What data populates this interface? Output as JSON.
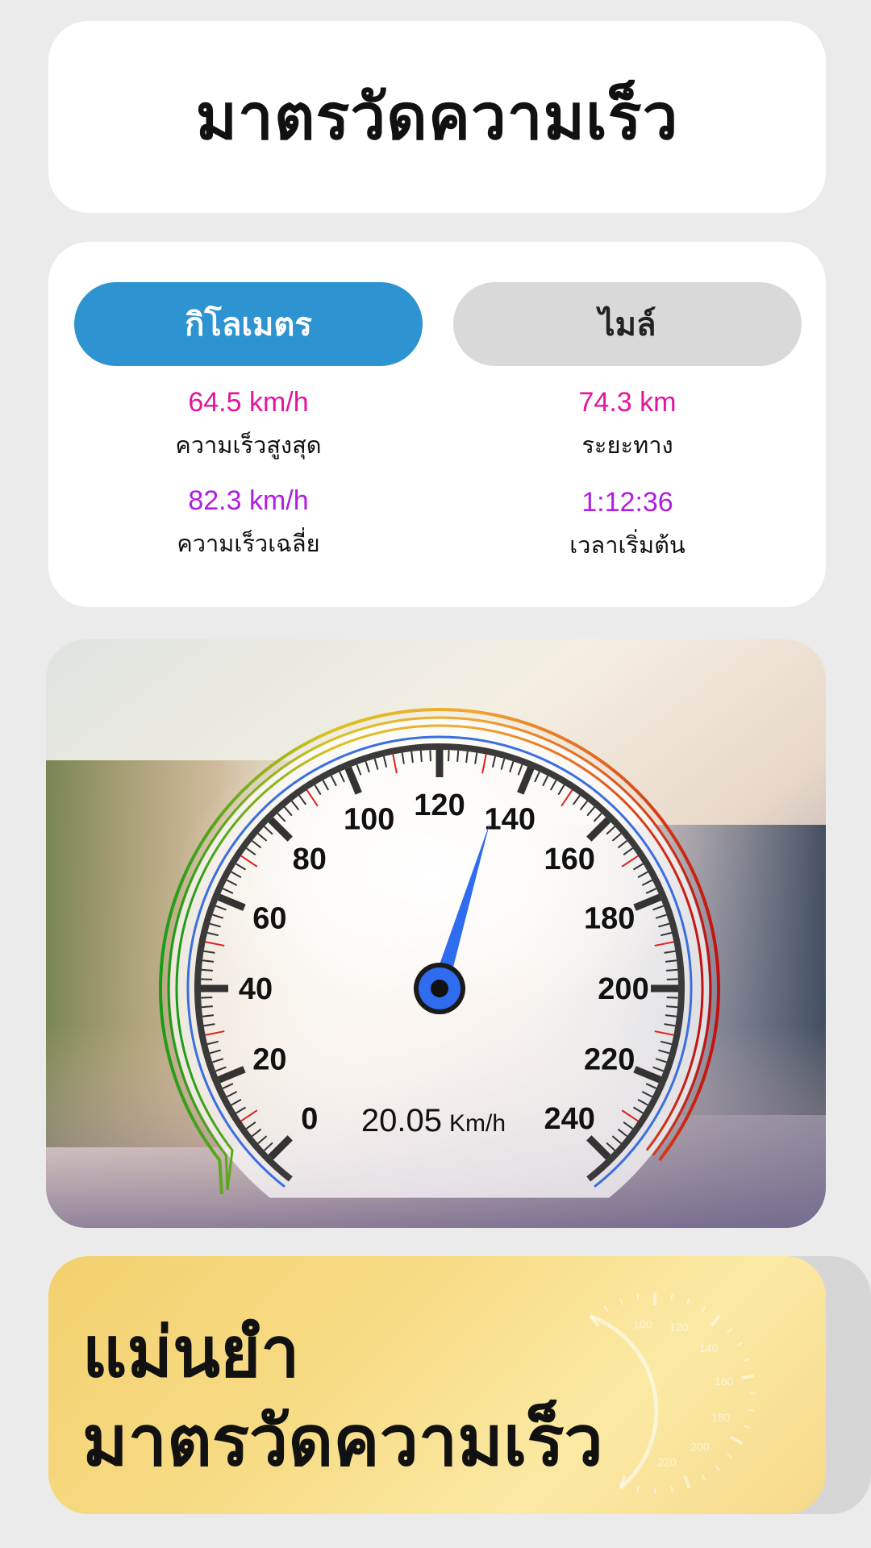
{
  "header": {
    "title": "มาตรวัดความเร็ว"
  },
  "units": {
    "km_label": "กิโลเมตร",
    "mile_label": "ไมล์",
    "selected": "km"
  },
  "stats": {
    "max_speed": {
      "value": "64.5 km/h",
      "label": "ความเร็วสูงสุด"
    },
    "distance": {
      "value": "74.3 km",
      "label": "ระยะทาง"
    },
    "avg_speed": {
      "value": "82.3 km/h",
      "label": "ความเร็วเฉลี่ย"
    },
    "elapsed": {
      "value": "1:12:36",
      "label": "เวลาเริ่มต้น"
    }
  },
  "gauge": {
    "min": 0,
    "max": 240,
    "major_ticks": [
      "0",
      "20",
      "40",
      "60",
      "80",
      "100",
      "120",
      "140",
      "160",
      "180",
      "200",
      "220",
      "240"
    ],
    "needle_value": 135,
    "readout_value": "20.05",
    "readout_unit": "Km/h",
    "colors": {
      "needle": "#2f6cf0",
      "inner_ring": "#3a6fe0",
      "minor_tick_red": "#e02020"
    }
  },
  "promo": {
    "line1": "แม่นยำ",
    "line2": "มาตรวัดความเร็ว",
    "gauge_labels": [
      "100",
      "120",
      "140",
      "160",
      "180",
      "200",
      "220"
    ]
  },
  "colors": {
    "primary": "#2d93d1",
    "pink": "#e2169c",
    "purple": "#b01fe0",
    "background": "#ebebeb"
  }
}
